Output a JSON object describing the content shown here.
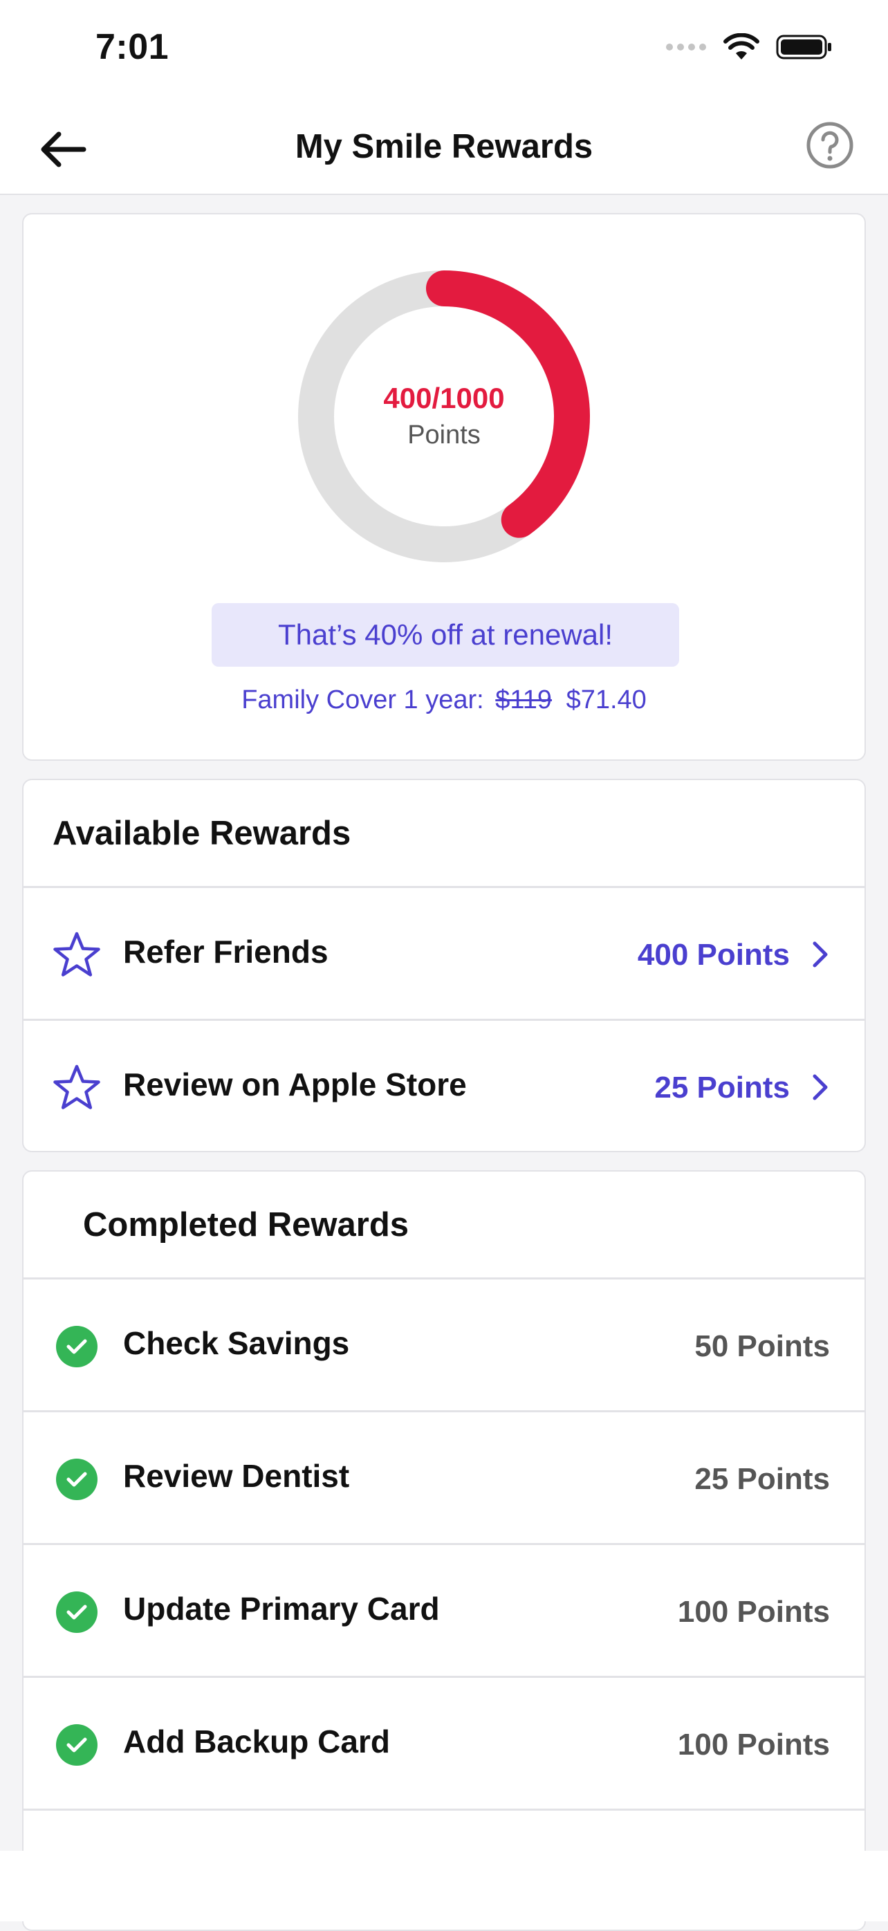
{
  "status_bar": {
    "time": "7:01"
  },
  "nav": {
    "title": "My Smile Rewards",
    "back_icon": "arrow-left-icon",
    "help_icon": "question-circle-icon"
  },
  "progress": {
    "value_text": "400/1000",
    "unit_text": "Points",
    "fraction": 0.4,
    "ring_color": "#e31b3f",
    "track_color": "#e0e0e0",
    "discount_text": "That’s 40% off at renewal!",
    "plan_label": "Family Cover 1 year:",
    "old_price": "$119",
    "new_price": "$71.40"
  },
  "available": {
    "title": "Available Rewards",
    "items": [
      {
        "label": "Refer Friends",
        "points": "400 Points",
        "icon": "star-icon"
      },
      {
        "label": "Review on Apple Store",
        "points": "25 Points",
        "icon": "star-icon"
      }
    ]
  },
  "completed": {
    "title": "Completed Rewards",
    "items": [
      {
        "label": "Check Savings",
        "points": "50 Points",
        "icon": "check-circle-icon"
      },
      {
        "label": "Review Dentist",
        "points": "25 Points",
        "icon": "check-circle-icon"
      },
      {
        "label": "Update Primary Card",
        "points": "100 Points",
        "icon": "check-circle-icon"
      },
      {
        "label": "Add Backup Card",
        "points": "100 Points",
        "icon": "check-circle-icon"
      }
    ]
  },
  "colors": {
    "accent": "#4a3fcf",
    "success": "#34b556",
    "danger": "#e31b3f"
  }
}
